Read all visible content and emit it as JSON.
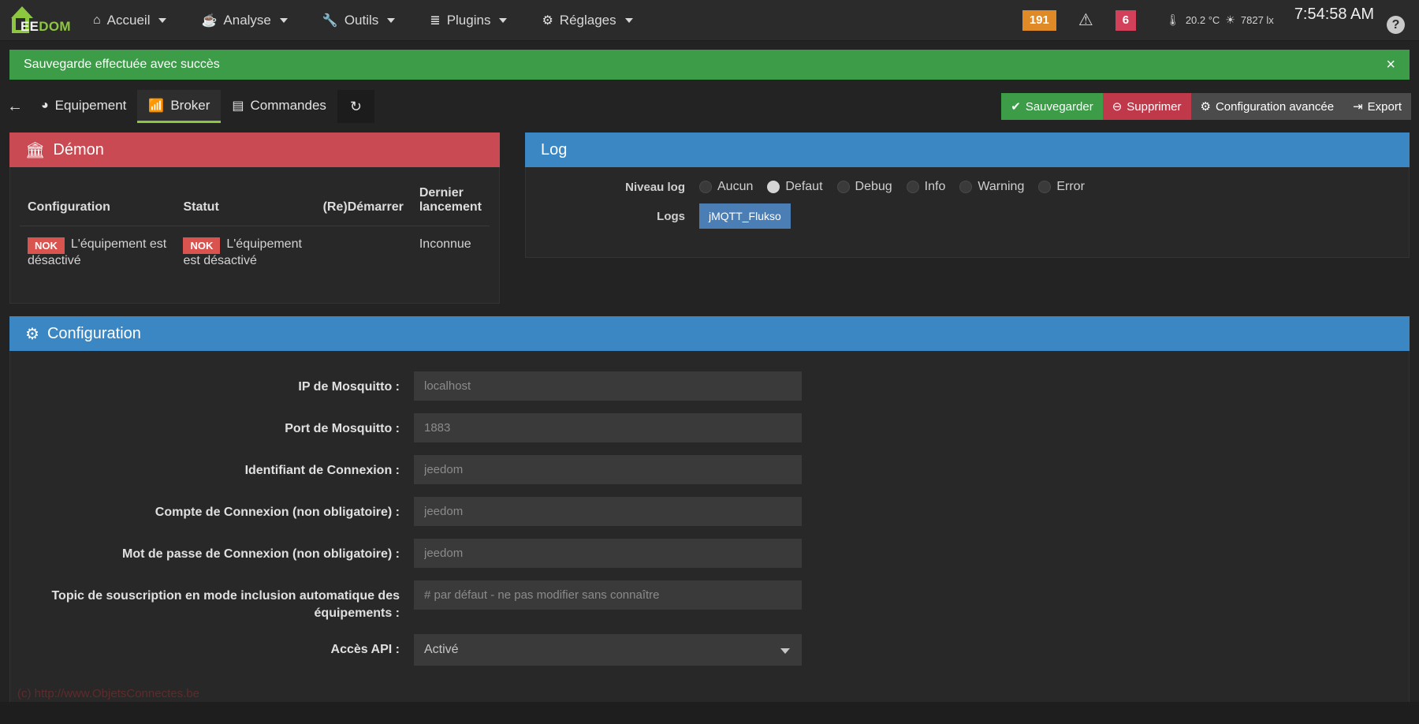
{
  "topnav": {
    "brand": {
      "ee": "EE",
      "dom": "DOM"
    },
    "menus": [
      {
        "label": "Accueil",
        "icon": "home-icon",
        "glyph": "⌂"
      },
      {
        "label": "Analyse",
        "icon": "stethoscope-icon",
        "glyph": "⚕"
      },
      {
        "label": "Outils",
        "icon": "wrench-icon",
        "glyph": "ὒ7"
      },
      {
        "label": "Plugins",
        "icon": "list-icon",
        "glyph": "≡"
      },
      {
        "label": "Réglages",
        "icon": "gear-icon",
        "glyph": "⚙"
      }
    ],
    "badge_orange": "191",
    "badge_red": "6",
    "warning_icon": "warning-triangle-icon",
    "temperature": "20.2 °C",
    "luminosity": "7827 lx",
    "clock": "7:54:58 AM",
    "help_label": "?"
  },
  "alert": {
    "message": "Sauvegarde effectuée avec succès",
    "close": "×",
    "color": "#3c9c47"
  },
  "tabbar": {
    "back": "←",
    "tabs": [
      {
        "label": "Equipement",
        "icon": "gauge-icon",
        "glyph": "◔",
        "active": false
      },
      {
        "label": "Broker",
        "icon": "rss-icon",
        "glyph": "◠",
        "active": true
      },
      {
        "label": "Commandes",
        "icon": "table-icon",
        "glyph": "▤",
        "active": false
      }
    ],
    "refresh_icon": "refresh-icon",
    "actions": [
      {
        "label": "Sauvegarder",
        "icon": "check-circle-icon",
        "style": "green"
      },
      {
        "label": "Supprimer",
        "icon": "minus-circle-icon",
        "style": "red"
      },
      {
        "label": "Configuration avancée",
        "icon": "gears-icon",
        "style": "grey"
      },
      {
        "label": "Export",
        "icon": "export-icon",
        "style": "grey"
      }
    ]
  },
  "daemon": {
    "title": "Démon",
    "icon": "bank-icon",
    "headers": [
      "Configuration",
      "Statut",
      "(Re)Démarrer",
      "Dernier lancement"
    ],
    "row": {
      "configuration_badge": "NOK",
      "configuration_text": "L'équipement est désactivé",
      "statut_badge": "NOK",
      "statut_text": "L'équipement est désactivé",
      "restart": "",
      "last_launch": "Inconnue"
    }
  },
  "log": {
    "title": "Log",
    "level_label": "Niveau log",
    "levels": [
      {
        "label": "Aucun",
        "selected": false
      },
      {
        "label": "Defaut",
        "selected": true
      },
      {
        "label": "Debug",
        "selected": false
      },
      {
        "label": "Info",
        "selected": false
      },
      {
        "label": "Warning",
        "selected": false
      },
      {
        "label": "Error",
        "selected": false
      }
    ],
    "logs_label": "Logs",
    "logs_button": "jMQTT_Flukso"
  },
  "configuration": {
    "title": "Configuration",
    "icon": "gears-icon",
    "fields": [
      {
        "label": "IP de Mosquitto :",
        "value": "",
        "placeholder": "localhost",
        "type": "text"
      },
      {
        "label": "Port de Mosquitto :",
        "value": "",
        "placeholder": "1883",
        "type": "text"
      },
      {
        "label": "Identifiant de Connexion :",
        "value": "",
        "placeholder": "jeedom",
        "type": "text"
      },
      {
        "label": "Compte de Connexion (non obligatoire) :",
        "value": "",
        "placeholder": "jeedom",
        "type": "text"
      },
      {
        "label": "Mot de passe de Connexion (non obligatoire) :",
        "value": "",
        "placeholder": "jeedom",
        "type": "text"
      },
      {
        "label": "Topic de souscription en mode inclusion automatique des équipements :",
        "value": "",
        "placeholder": "# par défaut - ne pas modifier sans connaître",
        "type": "text"
      },
      {
        "label": "Accès API :",
        "value": "Activé",
        "placeholder": "",
        "type": "select"
      }
    ]
  },
  "watermark": "(c) http://www.ObjetsConnectes.be"
}
